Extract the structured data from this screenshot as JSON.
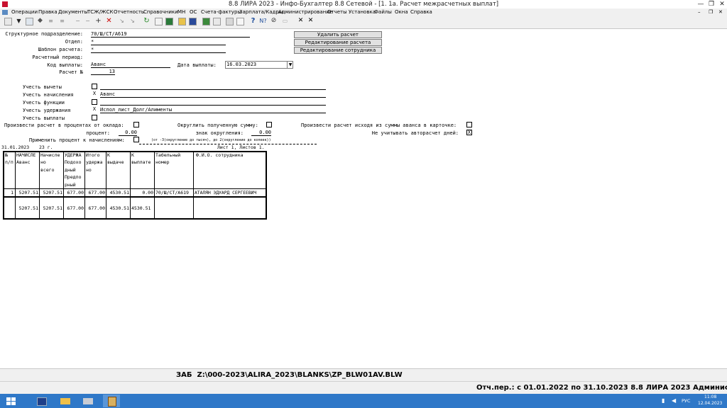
{
  "window": {
    "title": "8.8 ЛИРА 2023 - Инфо-Бухгалтер 8.8 Сетевой - [1. 1а. Расчет межрасчетных выплат]",
    "minimize": "—",
    "restore": "❐",
    "close": "✕"
  },
  "menu": [
    "Операции",
    "Правка",
    "Документы",
    "ТСЖ/ЖСК",
    "Отчетность",
    "Справочники",
    "МН",
    "ОС",
    "Счета-фактуры",
    "Зарплата/Кадры",
    "Администрирование",
    "Отчеты",
    "Установка",
    "Файлы",
    "Окна",
    "Справка"
  ],
  "mdi": {
    "minimize": "–",
    "restore": "❐",
    "close": "✕"
  },
  "form": {
    "struct_label": "Структурное подразделение:",
    "struct_value": "70/Ш/СТ/А619",
    "dept_label": "Отдел:",
    "dept_value": "*",
    "template_label": "Шаблон расчета:",
    "template_value": "*",
    "period_label": "Расчетный период:",
    "code_label": "Код выплаты:",
    "code_value": "Аванс",
    "date_label": "Дата выплаты:",
    "date_value": "16.03.2023",
    "calc_label": "Расчет №",
    "calc_value": "13"
  },
  "buttons": {
    "delete": "Удалить расчет",
    "edit_calc": "Редактирование расчета",
    "edit_emp": "Редактирование сотрудника"
  },
  "options": {
    "deductions_label": "Учесть вычеты",
    "deductions_mark": "",
    "deductions_value": "",
    "accruals_label": "Учесть начисления",
    "accruals_mark": "X",
    "accruals_value": "Аванс",
    "functions_label": "Учесть функции",
    "functions_mark": "",
    "functions_value": "",
    "withhold_label": "Учесть удержания",
    "withhold_mark": "X",
    "withhold_value": "Испол_лист_Долг/Алименты",
    "payments_label": "Учесть выплаты",
    "payments_mark": ""
  },
  "calc_opts": {
    "percent_salary_label": "Произвести расчет в процентах от оклада:",
    "percent_salary_mark": "",
    "round_label": "Округлить полученную сумму:",
    "round_mark": "",
    "advance_card_label": "Произвести расчет исходя из суммы аванса в карточке:",
    "advance_card_mark": "",
    "percent_label": "процент:",
    "percent_value": "0.00",
    "round_sign_label": "знак округления:",
    "round_sign_value": "0.00",
    "no_auto_label": "Не учитывать авторасчет дней:",
    "no_auto_mark": "X",
    "apply_percent_label": "Применить процент к начислениям:",
    "apply_percent_mark": "",
    "hint": "(от -3(округление до тысяч), до 2(округление до копеек))"
  },
  "report": {
    "date": "31.01.2023",
    "year": "23 г.",
    "page": "Лист 1, Листов 1.",
    "headers": [
      [
        "№",
        "п/п"
      ],
      [
        "НАЧИСЛЕ",
        "Аванс"
      ],
      [
        "Начисле",
        "но",
        "всего"
      ],
      [
        "УДЕРЖА",
        "Подохо",
        "дный",
        "Предпо",
        "рный"
      ],
      [
        "Итого",
        "удержа",
        "но"
      ],
      [
        "К",
        "выдаче"
      ],
      [
        "К",
        "выплате"
      ],
      [
        "Табельный",
        "номер"
      ],
      [
        "Ф.И.О. сотрудника"
      ]
    ],
    "row": [
      "1",
      "5207.51",
      "5207.51",
      "677.00",
      "677.00",
      "4530.51",
      "0.00",
      "70/Ш/СТ/А619",
      "АТАЛЯН ЭДУАРД СЕРГЕЕВИЧ"
    ],
    "total": [
      "",
      "5207.51",
      "5207.51",
      "677.00",
      "677.00",
      "4530.51",
      "4530.51",
      "",
      ""
    ]
  },
  "status": {
    "mode": "ЗАБ",
    "path": "Z:\\000-2023\\ALIRA_2023\\BLANKS\\ZP_BLW01AV.BLW",
    "period": "Отч.пер.: с 01.01.2022 по 31.10.2023 8.8 ЛИРА 2023 Администратор"
  },
  "tray": {
    "lang": "РУС",
    "time": "11:08",
    "date": "12.04.2023"
  }
}
